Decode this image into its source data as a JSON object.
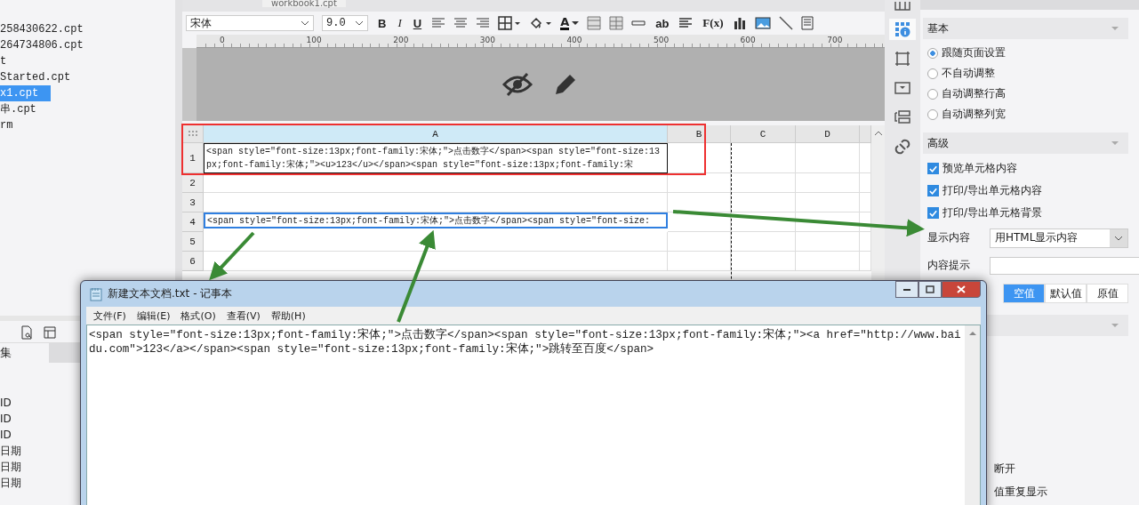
{
  "file_list": {
    "items": [
      {
        "label": "258430622.cpt",
        "selected": false
      },
      {
        "label": "264734806.cpt",
        "selected": false
      },
      {
        "label": "t",
        "selected": false
      },
      {
        "label": "Started.cpt",
        "selected": false
      },
      {
        "label": "x1.cpt",
        "selected": true
      },
      {
        "label": "串.cpt",
        "selected": false
      },
      {
        "label": "rm",
        "selected": false
      }
    ]
  },
  "bottom_panel": {
    "tabs": [
      {
        "label": "集",
        "selected": true
      }
    ],
    "items": [
      "ID",
      "ID",
      "ID",
      "日期",
      "日期",
      "日期"
    ]
  },
  "editor": {
    "tab": "workbook1.cpt",
    "toolbar": {
      "font": "宋体",
      "size": "9.0",
      "format_buttons": [
        "B",
        "I",
        "U"
      ],
      "font_color": "A",
      "text_tool": "ab",
      "formula": "F(x)"
    },
    "ruler": [
      "0",
      "100",
      "200",
      "300",
      "400",
      "500",
      "600",
      "700"
    ],
    "grid": {
      "columns": [
        "A",
        "B",
        "C",
        "D"
      ],
      "rows": [
        {
          "number": "1",
          "cell": "<span style=\"font-size:13px;font-family:宋体;\">点击数字</span><span style=\"font-size:13px;font-family:宋体;\"><u>123</u></span><span style=\"font-size:13px;font-family:宋",
          "selected": false,
          "highlighted": true
        },
        {
          "number": "2",
          "cell": "",
          "selected": false,
          "highlighted": false
        },
        {
          "number": "3",
          "cell": "",
          "selected": false,
          "highlighted": false
        },
        {
          "number": "4",
          "cell": "<span style=\"font-size:13px;font-family:宋体;\">点击数字</span><span style=\"font-size:",
          "selected": true,
          "highlighted": false
        },
        {
          "number": "5",
          "cell": "",
          "selected": false,
          "highlighted": false
        },
        {
          "number": "6",
          "cell": "",
          "selected": false,
          "highlighted": false
        }
      ]
    }
  },
  "side_tools": [
    {
      "kind": "grid",
      "selected": false
    },
    {
      "kind": "info",
      "selected": true
    },
    {
      "kind": "frame",
      "selected": false
    },
    {
      "kind": "dropdown",
      "selected": false
    },
    {
      "kind": "layers",
      "selected": false
    },
    {
      "kind": "link",
      "selected": false
    }
  ],
  "properties": {
    "basic": {
      "title": "基本",
      "options": [
        {
          "label": "跟随页面设置",
          "selected": true
        },
        {
          "label": "不自动调整",
          "selected": false
        },
        {
          "label": "自动调整行高",
          "selected": false
        },
        {
          "label": "自动调整列宽",
          "selected": false
        }
      ]
    },
    "advanced": {
      "title": "高级",
      "checks": [
        {
          "label": "预览单元格内容",
          "checked": true
        },
        {
          "label": "打印/导出单元格内容",
          "checked": true
        },
        {
          "label": "打印/导出单元格背景",
          "checked": true
        }
      ],
      "display_label": "显示内容",
      "display_value": "用HTML显示内容",
      "hint_label": "内容提示",
      "null_options": [
        {
          "label": "空值",
          "selected": true
        },
        {
          "label": "默认值",
          "selected": false
        },
        {
          "label": "原值",
          "selected": false
        }
      ]
    },
    "partial_texts": [
      "断开",
      "值重复显示"
    ]
  },
  "notepad": {
    "title": "新建文本文档.txt - 记事本",
    "menu": [
      "文件(F)",
      "编辑(E)",
      "格式(O)",
      "查看(V)",
      "帮助(H)"
    ],
    "content": "<span style=\"font-size:13px;font-family:宋体;\">点击数字</span><span style=\"font-size:13px;font-family:宋体;\"><a href=\"http://www.baidu.com\">123</a></span><span style=\"font-size:13px;font-family:宋体;\">跳转至百度</span>"
  }
}
